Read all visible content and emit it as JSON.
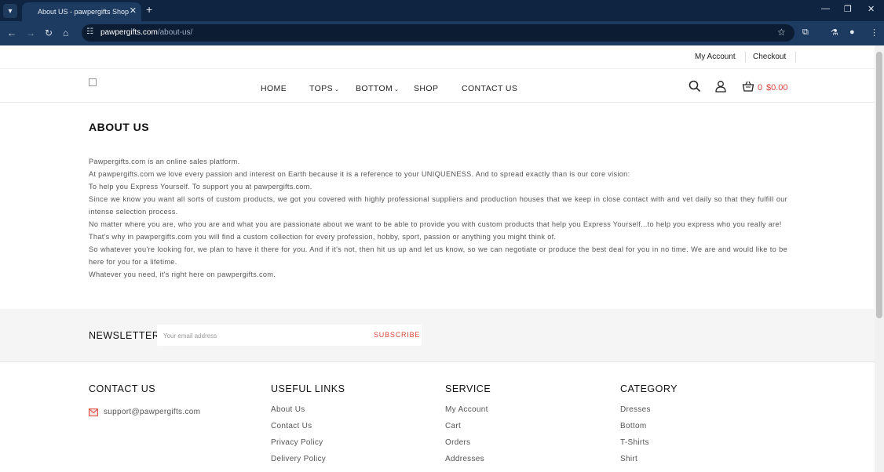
{
  "browser": {
    "tab_title": "About US - pawpergifts Shop",
    "url_host": "pawpergifts.com",
    "url_path": "/about-us/"
  },
  "topbar": {
    "my_account": "My Account",
    "checkout": "Checkout"
  },
  "nav": {
    "items": [
      "HOME",
      "TOPS",
      "BOTTOM",
      "SHOP",
      "CONTACT US"
    ],
    "cart_count": "0",
    "cart_total": "$0.00"
  },
  "about": {
    "title": "ABOUT US",
    "paragraphs": [
      "Pawpergifts.com is an online sales platform.",
      "At pawpergifts.com we love every passion and interest on Earth because it is a reference to your UNIQUENESS. And to spread exactly than is our core vision:",
      "To help you Express Yourself. To support you at pawpergifts.com.",
      "Since we know you want all sorts of custom products, we got you covered with highly professional suppliers and production houses that we keep in close contact with and vet daily so that they fulfill our intense selection process.",
      "No matter where you are, who you are and what you are passionate about we want to be able to provide you with custom products that help you Express Yourself...to help you express who you really are!",
      "That's why in pawpergifts.com you will find a custom collection for every profession, hobby, sport, passion or anything you might think of.",
      "So whatever you're looking for, we plan to have it there for you. And if it's not, then hit us up and let us know, so we can negotiate or produce the best deal for you in no time. We are and would like to be here for you  for a lifetime.",
      "Whatever you need, it's right here on pawpergifts.com."
    ]
  },
  "newsletter": {
    "title": "NEWSLETTER",
    "placeholder": "Your email address",
    "button": "SUBSCRIBE"
  },
  "footer": {
    "contact": {
      "title": "CONTACT US",
      "email": "support@pawpergifts.com"
    },
    "useful_links": {
      "title": "USEFUL LINKS",
      "items": [
        "About Us",
        "Contact Us",
        "Privacy Policy",
        "Delivery Policy"
      ]
    },
    "service": {
      "title": "SERVICE",
      "items": [
        "My Account",
        "Cart",
        "Orders",
        "Addresses"
      ]
    },
    "category": {
      "title": "CATEGORY",
      "items": [
        "Dresses",
        "Bottom",
        "T-Shirts",
        "Shirt"
      ]
    }
  },
  "colors": {
    "accent": "#d9443a",
    "chrome_dark": "#0f2440",
    "chrome_mid": "#1d3a60"
  }
}
